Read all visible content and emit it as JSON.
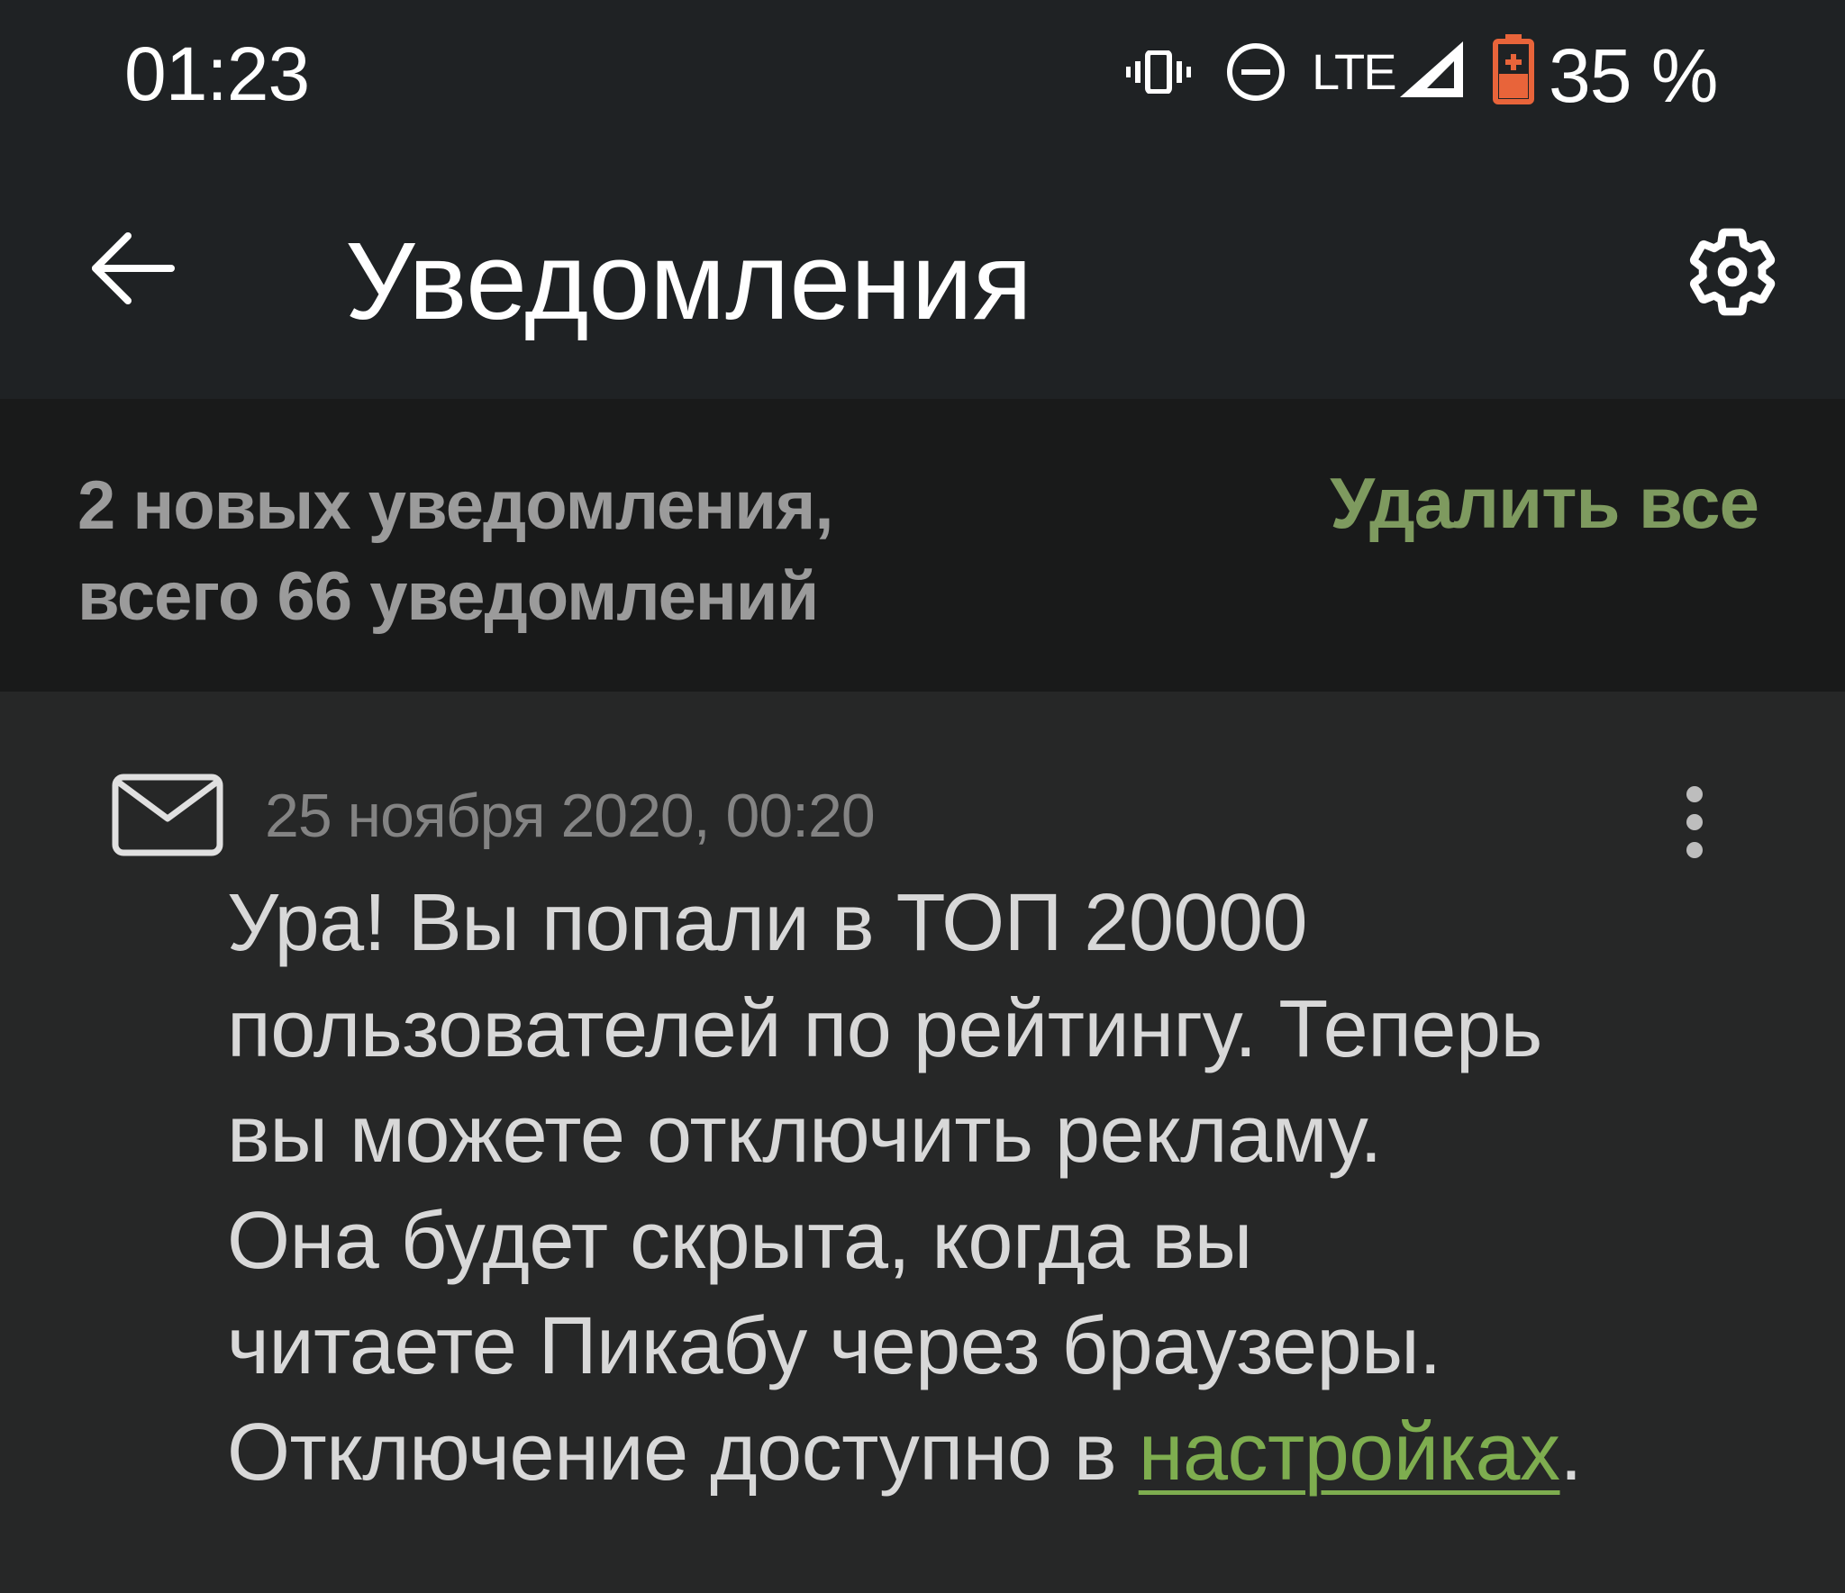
{
  "status_bar": {
    "time": "01:23",
    "network": "LTE",
    "battery": "35 %",
    "icons": [
      "vibrate-icon",
      "do-not-disturb-icon",
      "signal-icon",
      "battery-low-icon"
    ],
    "battery_color": "#e8643a"
  },
  "toolbar": {
    "title": "Уведомления",
    "back_icon": "arrow-left-icon",
    "settings_icon": "gear-icon"
  },
  "summary": {
    "line1": "2 новых уведомления,",
    "line2": "всего 66 уведомлений",
    "delete_all": "Удалить все"
  },
  "notification": {
    "icon": "mail-icon",
    "date": "25 ноября 2020, 00:20",
    "more_icon": "more-vertical-icon",
    "body_lines": [
      "Ура! Вы попали в ТОП 20000",
      "пользователей по рейтингу. Теперь",
      "вы можете отключить рекламу.",
      "Она будет скрыта, когда вы",
      "читаете Пикабу через браузеры."
    ],
    "last_line_prefix": "Отключение доступно в ",
    "link_text": "настройках",
    "last_line_suffix": "."
  },
  "colors": {
    "background": "#262727",
    "toolbar": "#1f2224",
    "summary_bar": "#191a1a",
    "accent_green": "#7e9a5f",
    "link_green": "#7ead4f"
  }
}
